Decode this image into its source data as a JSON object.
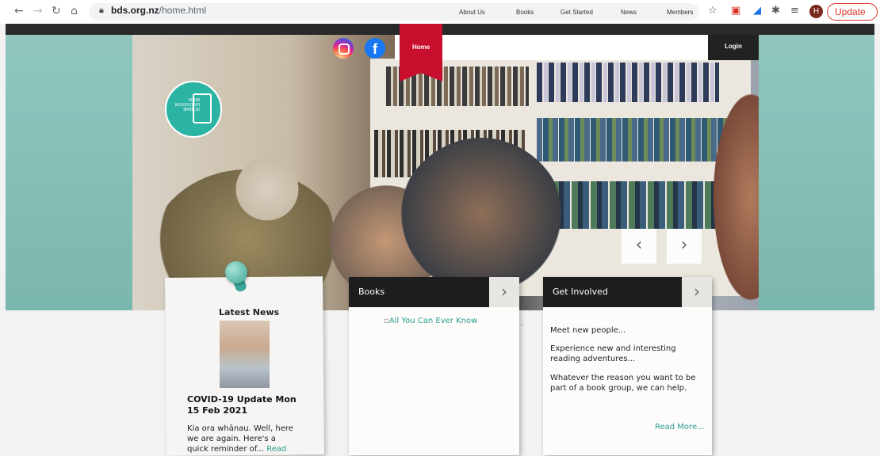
{
  "browser": {
    "url_domain": "bds.org.nz",
    "url_path": "/home.html",
    "update_label": "Update",
    "avatar_letter": "H"
  },
  "nav": {
    "items": [
      "Home",
      "About Us",
      "Books",
      "Get Started",
      "News",
      "Members"
    ],
    "login": "Login"
  },
  "hero": {
    "prev": "‹",
    "next": "›"
  },
  "latest_news": {
    "heading": "Latest News",
    "title": "COVID-19 Update Mon 15 Feb 2021",
    "body": "Kia ora whānau. Well, here we are again. Here's a quick reminder of...",
    "read": "Read"
  },
  "books_card": {
    "heading": "Books",
    "image_alt": "All You Can Ever Know"
  },
  "involved_card": {
    "heading": "Get Involved",
    "line1": "Meet new people...",
    "line2": "Experience new and interesting reading adventures...",
    "line3": "Whatever the reason you want to be part of a book group, we can help.",
    "read_more": "Read More..."
  },
  "colors": {
    "accent_red": "#c8102e",
    "teal": "#2a9d8f",
    "dark": "#1e1e1e"
  }
}
